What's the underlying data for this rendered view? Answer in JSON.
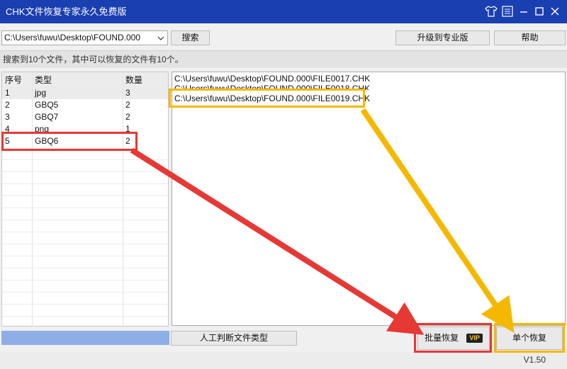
{
  "window": {
    "title": "CHK文件恢复专家永久免费版",
    "titlebar_color": "#1a3fb0",
    "controls": [
      "shirt-icon",
      "menu-icon",
      "minimize-icon",
      "maximize-icon",
      "close-icon"
    ]
  },
  "toolbar": {
    "path_value": "C:\\Users\\fuwu\\Desktop\\FOUND.000",
    "search_label": "搜索",
    "upgrade_label": "升级到专业版",
    "help_label": "帮助"
  },
  "status": {
    "message": "搜索到10个文件，其中可以恢复的文件有10个。"
  },
  "table": {
    "headers": [
      "序号",
      "类型",
      "数量"
    ],
    "rows": [
      {
        "num": "1",
        "type": "jpg",
        "count": "3"
      },
      {
        "num": "2",
        "type": "GBQ5",
        "count": "2"
      },
      {
        "num": "3",
        "type": "GBQ7",
        "count": "2"
      },
      {
        "num": "4",
        "type": "png",
        "count": "1"
      },
      {
        "num": "5",
        "type": "GBQ6",
        "count": "2"
      }
    ]
  },
  "files": [
    "C:\\Users\\fuwu\\Desktop\\FOUND.000\\FILE0017.CHK",
    "C:\\Users\\fuwu\\Desktop\\FOUND.000\\FILE0018.CHK",
    "C:\\Users\\fuwu\\Desktop\\FOUND.000\\FILE0019.CHK"
  ],
  "bottom": {
    "manual_type_label": "人工判断文件类型",
    "batch_label": "批量恢复",
    "vip_badge": "VIP",
    "single_label": "单个恢复",
    "version": "V1.50"
  },
  "colors": {
    "red_highlight": "#e53935",
    "yellow_highlight": "#f5b800",
    "progress_fill": "#8eaee6"
  }
}
